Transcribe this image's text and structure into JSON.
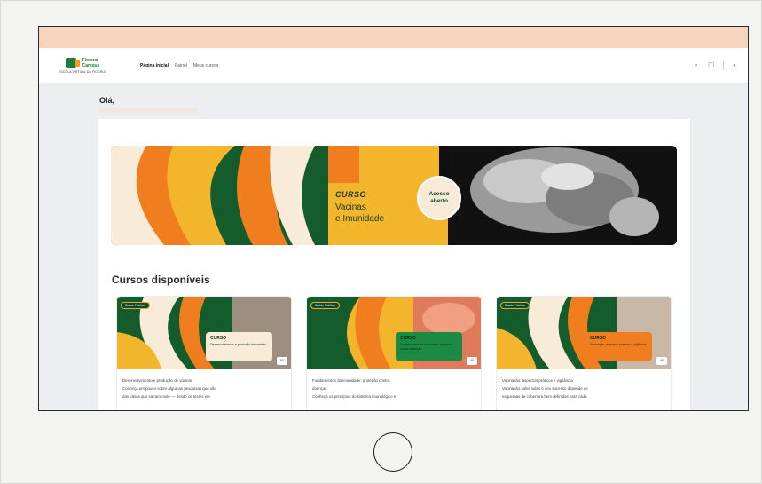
{
  "brand": {
    "name_line1": "Fiocruz",
    "name_line2": "Campus",
    "tagline": "ESCOLA VIRTUAL DA FIOCRUZ"
  },
  "nav": {
    "links": [
      "Página inicial",
      "Painel",
      "Meus cursos"
    ],
    "icons": [
      "bell-icon",
      "chat-icon",
      "user-icon"
    ]
  },
  "greeting": "Olá,",
  "banner": {
    "kicker": "CURSO",
    "line1": "Vacinas",
    "line2": "e Imunidade",
    "badge": "Acesso aberto",
    "colors": {
      "green": "#155c2c",
      "orange": "#f07e1e",
      "yellow": "#f3b52c",
      "cream": "#f8ecd8"
    }
  },
  "section_title": "Cursos disponíveis",
  "courses": [
    {
      "tag": "Saúde Pública",
      "kicker": "CURSO",
      "name": "Desenvolvimento e produção de vacinas",
      "hours": "60",
      "title": "Desenvolvimento e produção de vacinas",
      "desc1": "Conheça um pouco sobre algumas pesquisas que vão",
      "desc2": "das ideias que saíram onde — desde os testes em",
      "box_color": "#f8ecd8"
    },
    {
      "tag": "Saúde Pública",
      "kicker": "CURSO",
      "name": "Fundamentos da imunidade: proteção contra doenças",
      "hours": "40",
      "title": "Fundamentos da imunidade: proteção contra",
      "desc1": "doenças",
      "desc2": "Conheça os princípios do sistema imunológico e",
      "box_color": "#1d8a44"
    },
    {
      "tag": "Saúde Pública",
      "kicker": "CURSO",
      "name": "Vacinação: aspectos práticos e vigilância",
      "hours": "40",
      "title": "Vacinação: aspectos práticos e vigilância",
      "desc1": "Vacinação salva vidas e seu sucesso depende de",
      "desc2": "esquemas de cobertura bem definidos para cada",
      "box_color": "#f07e1e"
    }
  ]
}
